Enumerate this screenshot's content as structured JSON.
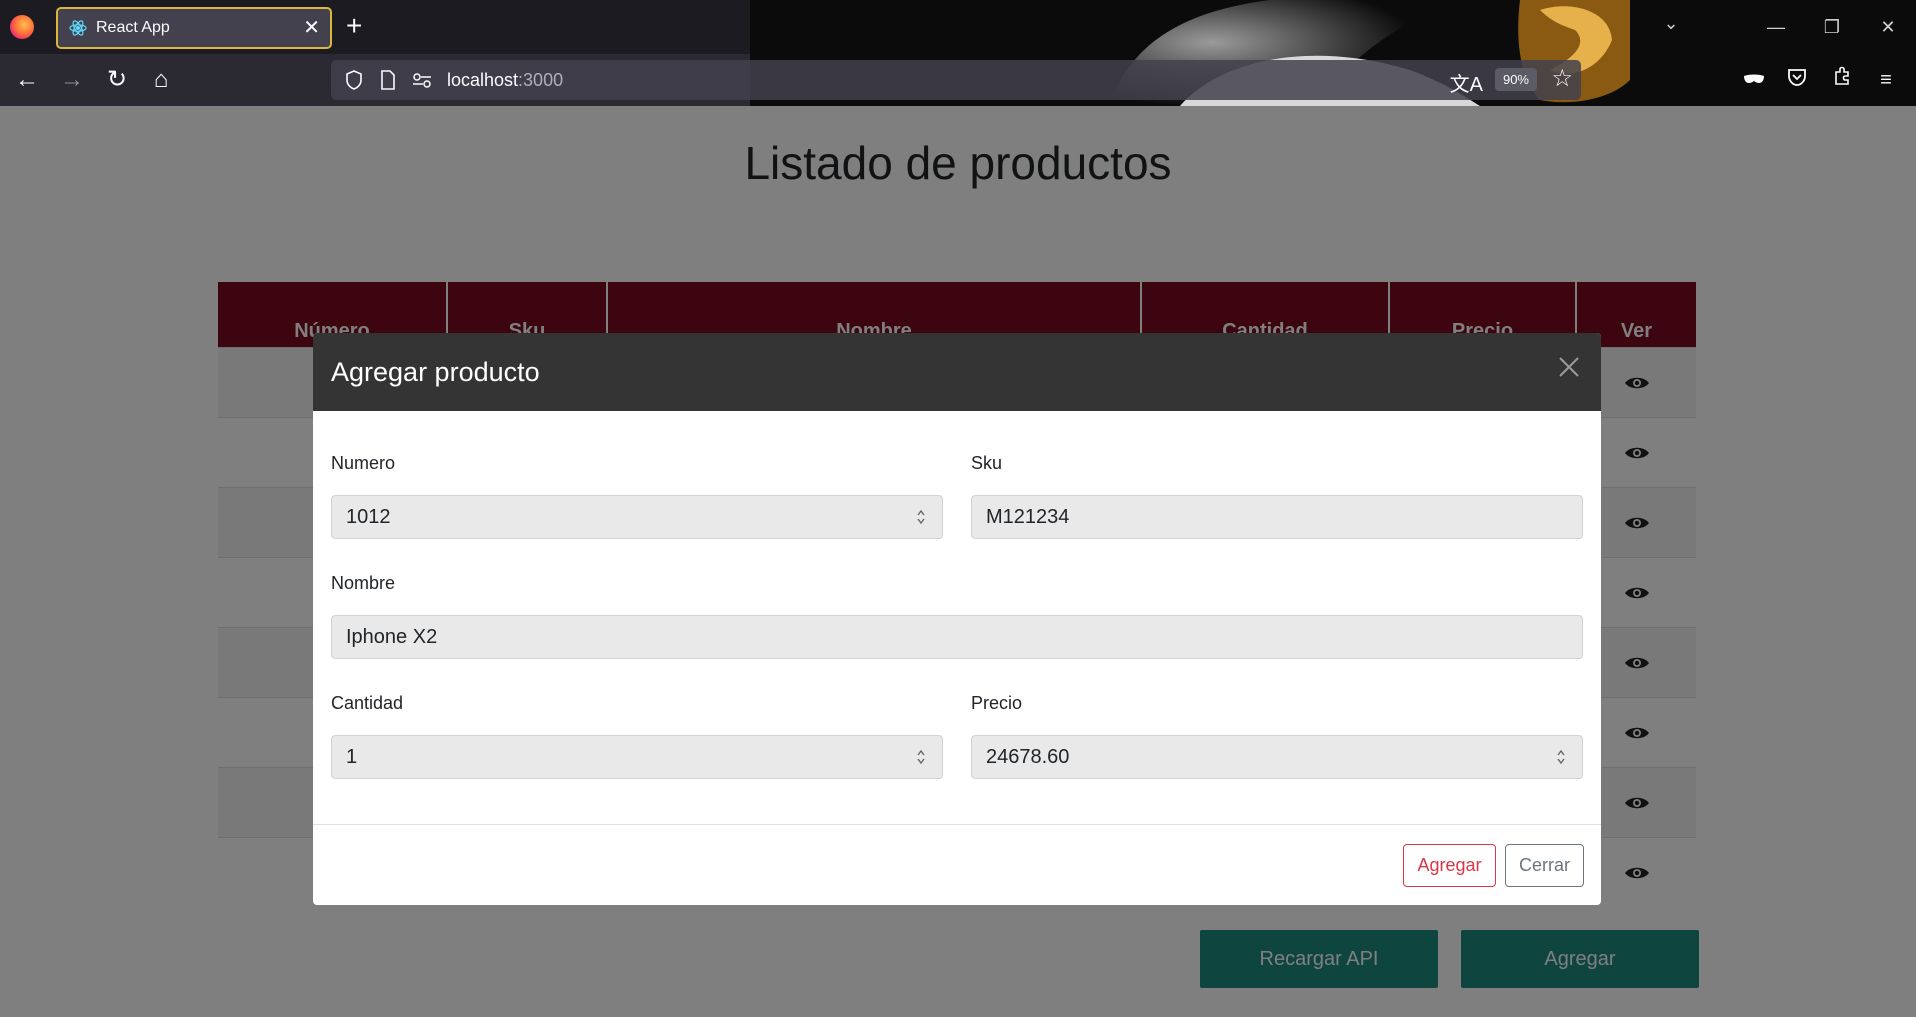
{
  "browser": {
    "tab_title": "React App",
    "url_host": "localhost",
    "url_port": ":3000",
    "zoom": "90%"
  },
  "page": {
    "title": "Listado de productos",
    "table": {
      "headers": [
        "Número",
        "Sku",
        "Nombre",
        "Cantidad",
        "Precio",
        "Ver"
      ],
      "row_count": 8
    },
    "buttons": {
      "reload": "Recargar API",
      "add": "Agregar"
    }
  },
  "modal": {
    "title": "Agregar producto",
    "fields": {
      "numero": {
        "label": "Numero",
        "value": "1012"
      },
      "sku": {
        "label": "Sku",
        "value": "M121234"
      },
      "nombre": {
        "label": "Nombre",
        "value": "Iphone X2"
      },
      "cantidad": {
        "label": "Cantidad",
        "value": "1"
      },
      "precio": {
        "label": "Precio",
        "value": "24678.60"
      }
    },
    "buttons": {
      "submit": "Agregar",
      "close": "Cerrar"
    }
  },
  "colors": {
    "table_header": "#7a0a1e",
    "teal_button": "#1e8b7f",
    "danger": "#dc3545",
    "secondary": "#6c757d"
  }
}
